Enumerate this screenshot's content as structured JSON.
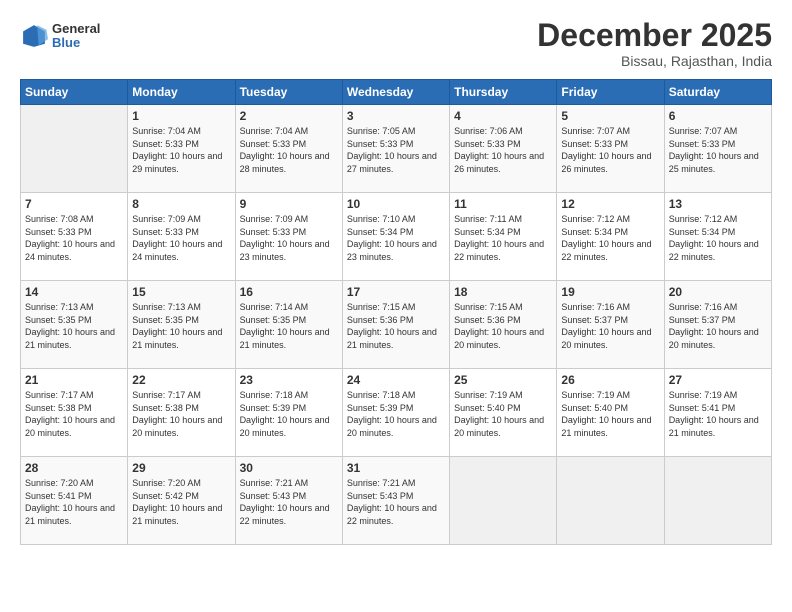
{
  "header": {
    "logo_line1": "General",
    "logo_line2": "Blue",
    "month": "December 2025",
    "location": "Bissau, Rajasthan, India"
  },
  "weekdays": [
    "Sunday",
    "Monday",
    "Tuesday",
    "Wednesday",
    "Thursday",
    "Friday",
    "Saturday"
  ],
  "weeks": [
    [
      {
        "day": "",
        "sunrise": "",
        "sunset": "",
        "daylight": ""
      },
      {
        "day": "1",
        "sunrise": "Sunrise: 7:04 AM",
        "sunset": "Sunset: 5:33 PM",
        "daylight": "Daylight: 10 hours and 29 minutes."
      },
      {
        "day": "2",
        "sunrise": "Sunrise: 7:04 AM",
        "sunset": "Sunset: 5:33 PM",
        "daylight": "Daylight: 10 hours and 28 minutes."
      },
      {
        "day": "3",
        "sunrise": "Sunrise: 7:05 AM",
        "sunset": "Sunset: 5:33 PM",
        "daylight": "Daylight: 10 hours and 27 minutes."
      },
      {
        "day": "4",
        "sunrise": "Sunrise: 7:06 AM",
        "sunset": "Sunset: 5:33 PM",
        "daylight": "Daylight: 10 hours and 26 minutes."
      },
      {
        "day": "5",
        "sunrise": "Sunrise: 7:07 AM",
        "sunset": "Sunset: 5:33 PM",
        "daylight": "Daylight: 10 hours and 26 minutes."
      },
      {
        "day": "6",
        "sunrise": "Sunrise: 7:07 AM",
        "sunset": "Sunset: 5:33 PM",
        "daylight": "Daylight: 10 hours and 25 minutes."
      }
    ],
    [
      {
        "day": "7",
        "sunrise": "Sunrise: 7:08 AM",
        "sunset": "Sunset: 5:33 PM",
        "daylight": "Daylight: 10 hours and 24 minutes."
      },
      {
        "day": "8",
        "sunrise": "Sunrise: 7:09 AM",
        "sunset": "Sunset: 5:33 PM",
        "daylight": "Daylight: 10 hours and 24 minutes."
      },
      {
        "day": "9",
        "sunrise": "Sunrise: 7:09 AM",
        "sunset": "Sunset: 5:33 PM",
        "daylight": "Daylight: 10 hours and 23 minutes."
      },
      {
        "day": "10",
        "sunrise": "Sunrise: 7:10 AM",
        "sunset": "Sunset: 5:34 PM",
        "daylight": "Daylight: 10 hours and 23 minutes."
      },
      {
        "day": "11",
        "sunrise": "Sunrise: 7:11 AM",
        "sunset": "Sunset: 5:34 PM",
        "daylight": "Daylight: 10 hours and 22 minutes."
      },
      {
        "day": "12",
        "sunrise": "Sunrise: 7:12 AM",
        "sunset": "Sunset: 5:34 PM",
        "daylight": "Daylight: 10 hours and 22 minutes."
      },
      {
        "day": "13",
        "sunrise": "Sunrise: 7:12 AM",
        "sunset": "Sunset: 5:34 PM",
        "daylight": "Daylight: 10 hours and 22 minutes."
      }
    ],
    [
      {
        "day": "14",
        "sunrise": "Sunrise: 7:13 AM",
        "sunset": "Sunset: 5:35 PM",
        "daylight": "Daylight: 10 hours and 21 minutes."
      },
      {
        "day": "15",
        "sunrise": "Sunrise: 7:13 AM",
        "sunset": "Sunset: 5:35 PM",
        "daylight": "Daylight: 10 hours and 21 minutes."
      },
      {
        "day": "16",
        "sunrise": "Sunrise: 7:14 AM",
        "sunset": "Sunset: 5:35 PM",
        "daylight": "Daylight: 10 hours and 21 minutes."
      },
      {
        "day": "17",
        "sunrise": "Sunrise: 7:15 AM",
        "sunset": "Sunset: 5:36 PM",
        "daylight": "Daylight: 10 hours and 21 minutes."
      },
      {
        "day": "18",
        "sunrise": "Sunrise: 7:15 AM",
        "sunset": "Sunset: 5:36 PM",
        "daylight": "Daylight: 10 hours and 20 minutes."
      },
      {
        "day": "19",
        "sunrise": "Sunrise: 7:16 AM",
        "sunset": "Sunset: 5:37 PM",
        "daylight": "Daylight: 10 hours and 20 minutes."
      },
      {
        "day": "20",
        "sunrise": "Sunrise: 7:16 AM",
        "sunset": "Sunset: 5:37 PM",
        "daylight": "Daylight: 10 hours and 20 minutes."
      }
    ],
    [
      {
        "day": "21",
        "sunrise": "Sunrise: 7:17 AM",
        "sunset": "Sunset: 5:38 PM",
        "daylight": "Daylight: 10 hours and 20 minutes."
      },
      {
        "day": "22",
        "sunrise": "Sunrise: 7:17 AM",
        "sunset": "Sunset: 5:38 PM",
        "daylight": "Daylight: 10 hours and 20 minutes."
      },
      {
        "day": "23",
        "sunrise": "Sunrise: 7:18 AM",
        "sunset": "Sunset: 5:39 PM",
        "daylight": "Daylight: 10 hours and 20 minutes."
      },
      {
        "day": "24",
        "sunrise": "Sunrise: 7:18 AM",
        "sunset": "Sunset: 5:39 PM",
        "daylight": "Daylight: 10 hours and 20 minutes."
      },
      {
        "day": "25",
        "sunrise": "Sunrise: 7:19 AM",
        "sunset": "Sunset: 5:40 PM",
        "daylight": "Daylight: 10 hours and 20 minutes."
      },
      {
        "day": "26",
        "sunrise": "Sunrise: 7:19 AM",
        "sunset": "Sunset: 5:40 PM",
        "daylight": "Daylight: 10 hours and 21 minutes."
      },
      {
        "day": "27",
        "sunrise": "Sunrise: 7:19 AM",
        "sunset": "Sunset: 5:41 PM",
        "daylight": "Daylight: 10 hours and 21 minutes."
      }
    ],
    [
      {
        "day": "28",
        "sunrise": "Sunrise: 7:20 AM",
        "sunset": "Sunset: 5:41 PM",
        "daylight": "Daylight: 10 hours and 21 minutes."
      },
      {
        "day": "29",
        "sunrise": "Sunrise: 7:20 AM",
        "sunset": "Sunset: 5:42 PM",
        "daylight": "Daylight: 10 hours and 21 minutes."
      },
      {
        "day": "30",
        "sunrise": "Sunrise: 7:21 AM",
        "sunset": "Sunset: 5:43 PM",
        "daylight": "Daylight: 10 hours and 22 minutes."
      },
      {
        "day": "31",
        "sunrise": "Sunrise: 7:21 AM",
        "sunset": "Sunset: 5:43 PM",
        "daylight": "Daylight: 10 hours and 22 minutes."
      },
      {
        "day": "",
        "sunrise": "",
        "sunset": "",
        "daylight": ""
      },
      {
        "day": "",
        "sunrise": "",
        "sunset": "",
        "daylight": ""
      },
      {
        "day": "",
        "sunrise": "",
        "sunset": "",
        "daylight": ""
      }
    ]
  ]
}
